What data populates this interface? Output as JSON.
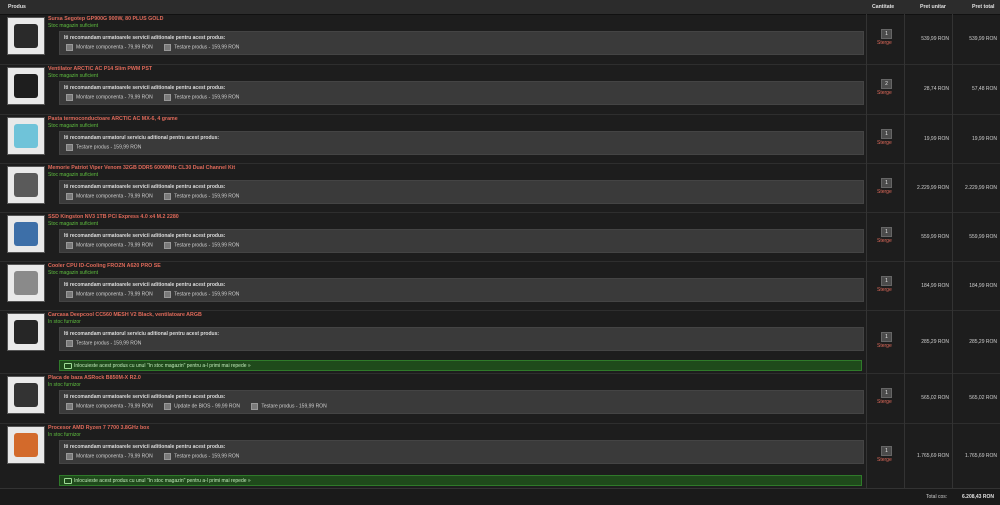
{
  "header": {
    "col_product": "Produs",
    "col_qty": "Cantitate",
    "col_unit": "Pret unitar",
    "col_total": "Pret total"
  },
  "remove_label": "Sterge",
  "banner_text": "Inlocuieste acest produs cu unul \"In stoc magazin\" pentru a-l primi mai repede »",
  "items": [
    {
      "name": "Sursa Segotep GP900G 900W, 80 PLUS GOLD",
      "stock": "Stoc magazin suficient",
      "services_title": "Iti recomandam urmatoarele servicii aditionale pentru acest produs:",
      "options": [
        "Montare componenta - 79,99 RON",
        "Testare produs - 159,99 RON"
      ],
      "qty": "1",
      "unit_price": "539,99 RON",
      "total_price": "539,99 RON",
      "icon": "psu-icon",
      "banner": false
    },
    {
      "name": "Ventilator ARCTIC AC P14 Slim PWM PST",
      "stock": "Stoc magazin suficient",
      "services_title": "Iti recomandam urmatoarele servicii aditionale pentru acest produs:",
      "options": [
        "Montare componenta - 79,99 RON",
        "Testare produs - 159,99 RON"
      ],
      "qty": "2",
      "unit_price": "28,74 RON",
      "total_price": "57,48 RON",
      "icon": "fan-icon",
      "banner": false
    },
    {
      "name": "Pasta termoconductoare ARCTIC AC MX-6, 4 grame",
      "stock": "Stoc magazin suficient",
      "services_title": "Iti recomandam urmatorul serviciu aditional pentru acest produs:",
      "options": [
        "Testare produs - 159,99 RON"
      ],
      "qty": "1",
      "unit_price": "19,99 RON",
      "total_price": "19,99 RON",
      "icon": "thermal-paste-icon",
      "banner": false
    },
    {
      "name": "Memorie Patriot Viper Venom 32GB DDR5 6000MHz CL30 Dual Channel Kit",
      "stock": "Stoc magazin suficient",
      "services_title": "Iti recomandam urmatoarele servicii aditionale pentru acest produs:",
      "options": [
        "Montare componenta - 79,99 RON",
        "Testare produs - 159,99 RON"
      ],
      "qty": "1",
      "unit_price": "2.229,99 RON",
      "total_price": "2.229,99 RON",
      "icon": "ram-icon",
      "banner": false
    },
    {
      "name": "SSD Kingston NV3 1TB PCI Express 4.0 x4 M.2 2280",
      "stock": "Stoc magazin suficient",
      "services_title": "Iti recomandam urmatoarele servicii aditionale pentru acest produs:",
      "options": [
        "Montare componenta - 79,99 RON",
        "Testare produs - 159,99 RON"
      ],
      "qty": "1",
      "unit_price": "559,99 RON",
      "total_price": "559,99 RON",
      "icon": "ssd-icon",
      "banner": false
    },
    {
      "name": "Cooler CPU ID-Cooling FROZN A620 PRO SE",
      "stock": "Stoc magazin suficient",
      "services_title": "Iti recomandam urmatoarele servicii aditionale pentru acest produs:",
      "options": [
        "Montare componenta - 79,99 RON",
        "Testare produs - 159,99 RON"
      ],
      "qty": "1",
      "unit_price": "184,99 RON",
      "total_price": "184,99 RON",
      "icon": "cpu-cooler-icon",
      "banner": false
    },
    {
      "name": "Carcasa Deepcool CC560 MESH V2 Black, ventilatoare ARGB",
      "stock": "In stoc furnizor",
      "services_title": "Iti recomandam urmatorul serviciu aditional pentru acest produs:",
      "options": [
        "Testare produs - 159,99 RON"
      ],
      "qty": "1",
      "unit_price": "285,29 RON",
      "total_price": "285,29 RON",
      "icon": "pc-case-icon",
      "banner": true
    },
    {
      "name": "Placa de baza ASRock B850M-X R2.0",
      "stock": "In stoc furnizor",
      "services_title": "Iti recomandam urmatoarele servicii aditionale pentru acest produs:",
      "options": [
        "Montare componenta - 79,99 RON",
        "Update de BIOS - 99,99 RON",
        "Testare produs - 159,99 RON"
      ],
      "qty": "1",
      "unit_price": "565,02 RON",
      "total_price": "565,02 RON",
      "icon": "motherboard-icon",
      "banner": false
    },
    {
      "name": "Procesor AMD Ryzen 7 7700 3.8GHz box",
      "stock": "In stoc furnizor",
      "services_title": "Iti recomandam urmatoarele servicii aditionale pentru acest produs:",
      "options": [
        "Montare componenta - 79,99 RON",
        "Testare produs - 159,99 RON"
      ],
      "qty": "1",
      "unit_price": "1.765,69 RON",
      "total_price": "1.765,69 RON",
      "icon": "cpu-box-icon",
      "banner": true
    }
  ],
  "footer": {
    "total_label": "Total cos:",
    "total_value": "6.208,43 RON"
  },
  "colors": {
    "product_name": "#e06a5a",
    "stock_ok": "#5fbf3f",
    "banner_bg": "#1f4a1b"
  }
}
